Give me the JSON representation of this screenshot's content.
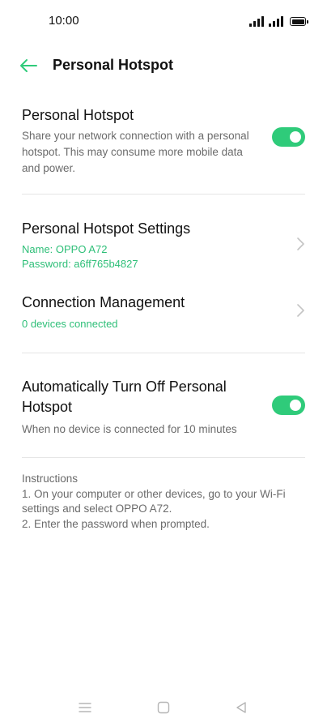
{
  "status_bar": {
    "time": "10:00"
  },
  "header": {
    "title": "Personal Hotspot",
    "back_icon": "back-arrow-icon"
  },
  "hotspot": {
    "title": "Personal Hotspot",
    "description": "Share your network connection with a personal hotspot. This may consume more mobile data and power.",
    "enabled": true
  },
  "settings": {
    "title": "Personal Hotspot Settings",
    "name": "Name: OPPO A72",
    "password": "Password: a6ff765b4827"
  },
  "connection": {
    "title": "Connection Management",
    "status": "0 devices connected"
  },
  "auto_off": {
    "title": "Automatically Turn Off Personal Hotspot",
    "description": "When no device is connected for 10 minutes",
    "enabled": true
  },
  "instructions": {
    "heading": "Instructions",
    "step1": "1. On your computer or other devices, go to your Wi-Fi settings and select OPPO A72.",
    "step2": "2. Enter the password when prompted."
  },
  "colors": {
    "accent": "#2fcb7a",
    "accent_text": "#2ebf78",
    "secondary_text": "#6b6b6b",
    "divider": "#e6e6e6"
  }
}
